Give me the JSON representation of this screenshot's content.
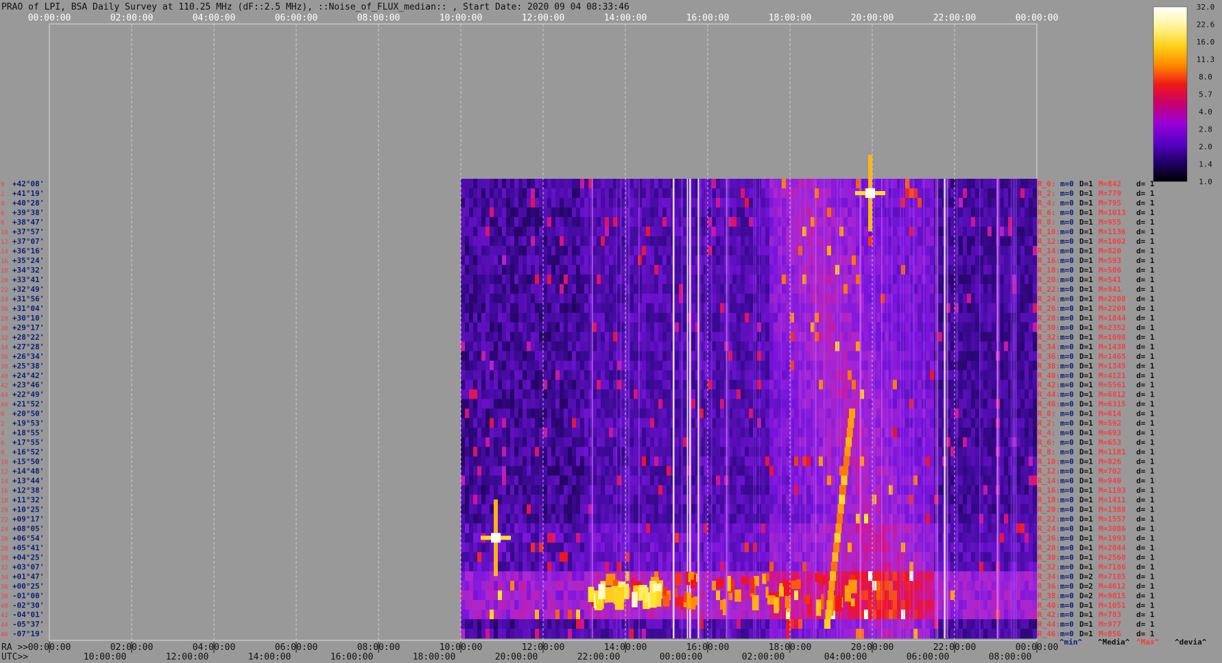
{
  "title": "PRAO of LPI, BSA Daily Survey at 110.25 MHz (dF::2.5 MHz), ::Noise_of_FLUX_median:: , Start Date: 2020 09 04 08:33:46",
  "colors": {
    "background": "#999999",
    "label_red": "#ff3b3b",
    "label_blue": "#0a1f7a",
    "grid": "#d8d8d8"
  },
  "chart_data": {
    "type": "heatmap",
    "top_axis_ticks": [
      "00:00:00",
      "02:00:00",
      "04:00:00",
      "06:00:00",
      "08:00:00",
      "10:00:00",
      "12:00:00",
      "14:00:00",
      "16:00:00",
      "18:00:00",
      "20:00:00",
      "22:00:00",
      "00:00:00"
    ],
    "ra_axis_prefix": "RA >>",
    "ra_axis_ticks": [
      "00:00:00",
      "02:00:00",
      "04:00:00",
      "06:00:00",
      "08:00:00",
      "10:00:00",
      "12:00:00",
      "14:00:00",
      "16:00:00",
      "18:00:00",
      "20:00:00",
      "22:00:00",
      "00:00:00"
    ],
    "utc_axis_prefix": "UTC>>",
    "utc_axis_ticks": [
      "10:00:00",
      "12:00:00",
      "14:00:00",
      "16:00:00",
      "18:00:00",
      "20:00:00",
      "22:00:00",
      "00:00:00",
      "02:00:00",
      "04:00:00",
      "06:00:00",
      "08:00:00"
    ],
    "data_start_hour": 10.0,
    "data_end_hour": 24.0,
    "beams": [
      {
        "n": "0",
        "dec": "+42°08'"
      },
      {
        "n": "2",
        "dec": "+41°19'"
      },
      {
        "n": "4",
        "dec": "+40°28'"
      },
      {
        "n": "6",
        "dec": "+39°38'"
      },
      {
        "n": "8",
        "dec": "+38°47'"
      },
      {
        "n": "10",
        "dec": "+37°57'"
      },
      {
        "n": "12",
        "dec": "+37°07'"
      },
      {
        "n": "14",
        "dec": "+36°16'"
      },
      {
        "n": "16",
        "dec": "+35°24'"
      },
      {
        "n": "18",
        "dec": "+34°32'"
      },
      {
        "n": "20",
        "dec": "+33°41'"
      },
      {
        "n": "22",
        "dec": "+32°49'"
      },
      {
        "n": "24",
        "dec": "+31°56'"
      },
      {
        "n": "26",
        "dec": "+31°04'"
      },
      {
        "n": "28",
        "dec": "+30°10'"
      },
      {
        "n": "30",
        "dec": "+29°17'"
      },
      {
        "n": "32",
        "dec": "+28°22'"
      },
      {
        "n": "34",
        "dec": "+27°28'"
      },
      {
        "n": "36",
        "dec": "+26°34'"
      },
      {
        "n": "38",
        "dec": "+25°38'"
      },
      {
        "n": "40",
        "dec": "+24°42'"
      },
      {
        "n": "42",
        "dec": "+23°46'"
      },
      {
        "n": "44",
        "dec": "+22°49'"
      },
      {
        "n": "46",
        "dec": "+21°52'"
      },
      {
        "n": "0",
        "dec": "+20°50'"
      },
      {
        "n": "2",
        "dec": "+19°53'"
      },
      {
        "n": "4",
        "dec": "+18°55'"
      },
      {
        "n": "6",
        "dec": "+17°55'"
      },
      {
        "n": "8",
        "dec": "+16°52'"
      },
      {
        "n": "10",
        "dec": "+15°50'"
      },
      {
        "n": "12",
        "dec": "+14°48'"
      },
      {
        "n": "14",
        "dec": "+13°44'"
      },
      {
        "n": "16",
        "dec": "+12°38'"
      },
      {
        "n": "18",
        "dec": "+11°32'"
      },
      {
        "n": "20",
        "dec": "+10°25'"
      },
      {
        "n": "22",
        "dec": "+09°17'"
      },
      {
        "n": "24",
        "dec": "+08°05'"
      },
      {
        "n": "26",
        "dec": "+06°54'"
      },
      {
        "n": "28",
        "dec": "+05°41'"
      },
      {
        "n": "30",
        "dec": "+04°25'"
      },
      {
        "n": "32",
        "dec": "+03°07'"
      },
      {
        "n": "34",
        "dec": "+01°47'"
      },
      {
        "n": "36",
        "dec": "+00°25'"
      },
      {
        "n": "38",
        "dec": "-01°00'"
      },
      {
        "n": "40",
        "dec": "-02°30'"
      },
      {
        "n": "42",
        "dec": "-04°01'"
      },
      {
        "n": "44",
        "dec": "-05°37'"
      },
      {
        "n": "46",
        "dec": "-07°19'"
      }
    ],
    "right_stats": [
      {
        "r": "R_0:",
        "m": "m=0",
        "d": "D=1",
        "M": "M=842",
        "dev": "d= 1"
      },
      {
        "r": "R_2:",
        "m": "m=0",
        "d": "D=1",
        "M": "M=779",
        "dev": "d= 1"
      },
      {
        "r": "R_4:",
        "m": "m=0",
        "d": "D=1",
        "M": "M=795",
        "dev": "d= 1"
      },
      {
        "r": "R_6:",
        "m": "m=0",
        "d": "D=1",
        "M": "M=1013",
        "dev": "d= 1"
      },
      {
        "r": "R_8:",
        "m": "m=0",
        "d": "D=1",
        "M": "M=955",
        "dev": "d= 1"
      },
      {
        "r": "R_10:",
        "m": "m=0",
        "d": "D=1",
        "M": "M=1136",
        "dev": "d= 1"
      },
      {
        "r": "R_12:",
        "m": "m=0",
        "d": "D=1",
        "M": "M=1002",
        "dev": "d= 1"
      },
      {
        "r": "R_14:",
        "m": "m=0",
        "d": "D=1",
        "M": "M=820",
        "dev": "d= 1"
      },
      {
        "r": "R_16:",
        "m": "m=0",
        "d": "D=1",
        "M": "M=593",
        "dev": "d= 1"
      },
      {
        "r": "R_18:",
        "m": "m=0",
        "d": "D=1",
        "M": "M=506",
        "dev": "d= 1"
      },
      {
        "r": "R_20:",
        "m": "m=0",
        "d": "D=1",
        "M": "M=541",
        "dev": "d= 1"
      },
      {
        "r": "R_22:",
        "m": "m=0",
        "d": "D=1",
        "M": "M=941",
        "dev": "d= 1"
      },
      {
        "r": "R_24:",
        "m": "m=0",
        "d": "D=1",
        "M": "M=2208",
        "dev": "d= 1"
      },
      {
        "r": "R_26:",
        "m": "m=0",
        "d": "D=1",
        "M": "M=2209",
        "dev": "d= 1"
      },
      {
        "r": "R_28:",
        "m": "m=0",
        "d": "D=1",
        "M": "M=1844",
        "dev": "d= 1"
      },
      {
        "r": "R_30:",
        "m": "m=0",
        "d": "D=1",
        "M": "M=2352",
        "dev": "d= 1"
      },
      {
        "r": "R_32:",
        "m": "m=0",
        "d": "D=1",
        "M": "M=1098",
        "dev": "d= 1"
      },
      {
        "r": "R_34:",
        "m": "m=0",
        "d": "D=1",
        "M": "M=1430",
        "dev": "d= 1"
      },
      {
        "r": "R_36:",
        "m": "m=0",
        "d": "D=1",
        "M": "M=1465",
        "dev": "d= 1"
      },
      {
        "r": "R_38:",
        "m": "m=0",
        "d": "D=1",
        "M": "M=1345",
        "dev": "d= 1"
      },
      {
        "r": "R_40:",
        "m": "m=0",
        "d": "D=1",
        "M": "M=4121",
        "dev": "d= 1"
      },
      {
        "r": "R_42:",
        "m": "m=0",
        "d": "D=1",
        "M": "M=5561",
        "dev": "d= 1"
      },
      {
        "r": "R_44:",
        "m": "m=0",
        "d": "D=1",
        "M": "M=6812",
        "dev": "d= 1"
      },
      {
        "r": "R_46:",
        "m": "m=0",
        "d": "D=1",
        "M": "M=6315",
        "dev": "d= 1"
      },
      {
        "r": "R_0:",
        "m": "m=0",
        "d": "D=1",
        "M": "M=614",
        "dev": "d= 1"
      },
      {
        "r": "R_2:",
        "m": "m=0",
        "d": "D=1",
        "M": "M=592",
        "dev": "d= 1"
      },
      {
        "r": "R_4:",
        "m": "m=0",
        "d": "D=1",
        "M": "M=693",
        "dev": "d= 1"
      },
      {
        "r": "R_6:",
        "m": "m=0",
        "d": "D=1",
        "M": "M=653",
        "dev": "d= 1"
      },
      {
        "r": "R_8:",
        "m": "m=0",
        "d": "D=1",
        "M": "M=1181",
        "dev": "d= 1"
      },
      {
        "r": "R_10:",
        "m": "m=0",
        "d": "D=1",
        "M": "M=826",
        "dev": "d= 1"
      },
      {
        "r": "R_12:",
        "m": "m=0",
        "d": "D=1",
        "M": "M=702",
        "dev": "d= 1"
      },
      {
        "r": "R_14:",
        "m": "m=0",
        "d": "D=1",
        "M": "M=940",
        "dev": "d= 1"
      },
      {
        "r": "R_16:",
        "m": "m=0",
        "d": "D=1",
        "M": "M=1193",
        "dev": "d= 1"
      },
      {
        "r": "R_18:",
        "m": "m=0",
        "d": "D=1",
        "M": "M=1411",
        "dev": "d= 1"
      },
      {
        "r": "R_20:",
        "m": "m=0",
        "d": "D=1",
        "M": "M=1388",
        "dev": "d= 1"
      },
      {
        "r": "R_22:",
        "m": "m=0",
        "d": "D=1",
        "M": "M=1557",
        "dev": "d= 1"
      },
      {
        "r": "R_24:",
        "m": "m=0",
        "d": "D=1",
        "M": "M=3086",
        "dev": "d= 1"
      },
      {
        "r": "R_26:",
        "m": "m=0",
        "d": "D=1",
        "M": "M=1993",
        "dev": "d= 1"
      },
      {
        "r": "R_28:",
        "m": "m=0",
        "d": "D=1",
        "M": "M=2044",
        "dev": "d= 1"
      },
      {
        "r": "R_30:",
        "m": "m=0",
        "d": "D=1",
        "M": "M=2560",
        "dev": "d= 1"
      },
      {
        "r": "R_32:",
        "m": "m=0",
        "d": "D=1",
        "M": "M=7186",
        "dev": "d= 1"
      },
      {
        "r": "R_34:",
        "m": "m=0",
        "d": "D=2",
        "M": "M=7185",
        "dev": "d= 1"
      },
      {
        "r": "R_36:",
        "m": "m=0",
        "d": "D=2",
        "M": "M=4612",
        "dev": "d= 1"
      },
      {
        "r": "R_38:",
        "m": "m=0",
        "d": "D=2",
        "M": "M=9015",
        "dev": "d= 1"
      },
      {
        "r": "R_40:",
        "m": "m=0",
        "d": "D=1",
        "M": "M=1051",
        "dev": "d= 1"
      },
      {
        "r": "R_42:",
        "m": "m=0",
        "d": "D=1",
        "M": "M=783",
        "dev": "d= 1"
      },
      {
        "r": "R_44:",
        "m": "m=0",
        "d": "D=1",
        "M": "M=977",
        "dev": "d= 1"
      },
      {
        "r": "R_46:",
        "m": "m=0",
        "d": "D=1",
        "M": "M=856",
        "dev": "d= 1"
      }
    ],
    "stats_legend": [
      "^min^",
      "^Media^",
      "^Max^",
      "^devia^"
    ],
    "colorbar": {
      "labels": [
        "32.0",
        "22.6",
        "16.0",
        "11.3",
        "8.0",
        "5.7",
        "4.0",
        "2.8",
        "2.0",
        "1.4",
        "1.0"
      ],
      "stops": [
        "#ffffff",
        "#fff59a",
        "#ffd21a",
        "#ff8a00",
        "#f01818",
        "#c8006e",
        "#9a00d8",
        "#5a00c8",
        "#20006a",
        "#000000"
      ]
    },
    "features": {
      "bright_burst_band": {
        "beam_from": 41,
        "beam_to": 44,
        "hour_from": 13.0,
        "hour_to": 19.5
      },
      "strong_burst_center": {
        "beam": 43,
        "hour_from": 13.0,
        "hour_to": 14.8
      },
      "point_source_a": {
        "beam": 37,
        "hour": 10.85
      },
      "point_source_b": {
        "beam": 1,
        "hour": 19.95
      },
      "diagonal_track": {
        "beam_from": 46,
        "beam_to": 24,
        "hour_from": 18.9,
        "hour_to": 19.5
      }
    }
  }
}
